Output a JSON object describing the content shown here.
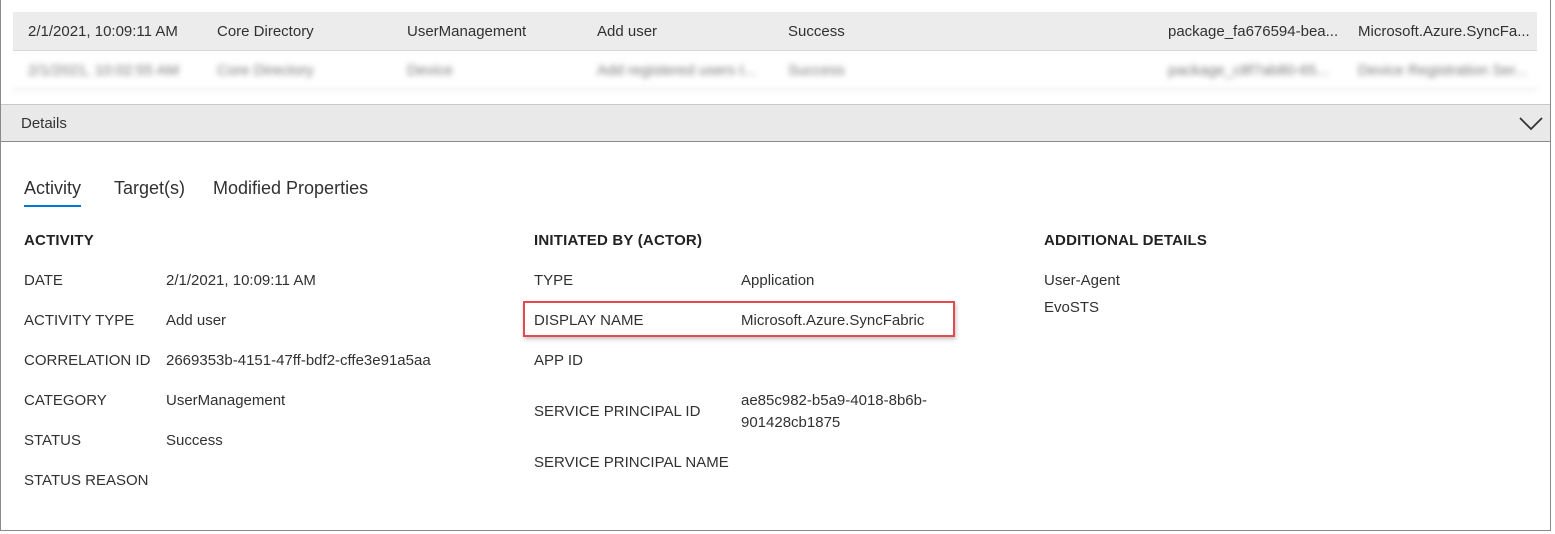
{
  "table": {
    "rows": [
      {
        "date": "2/1/2021, 10:09:11 AM",
        "service": "Core Directory",
        "category": "UserManagement",
        "activity": "Add user",
        "status": "Success",
        "correlation": "package_fa676594-bea...",
        "initiator": "Microsoft.Azure.SyncFa..."
      },
      {
        "date": "2/1/2021, 10:02:55 AM",
        "service": "Core Directory",
        "category": "Device",
        "activity": "Add registered users t...",
        "status": "Success",
        "correlation": "package_c8f7ab80-65...",
        "initiator": "Device Registration Ser..."
      }
    ]
  },
  "details": {
    "bar_label": "Details",
    "tabs": [
      "Activity",
      "Target(s)",
      "Modified Properties"
    ],
    "active_tab": "Activity",
    "activity": {
      "title": "ACTIVITY",
      "fields": [
        {
          "label": "DATE",
          "value": "2/1/2021, 10:09:11 AM"
        },
        {
          "label": "ACTIVITY TYPE",
          "value": "Add user"
        },
        {
          "label": "CORRELATION ID",
          "value": "2669353b-4151-47ff-bdf2-cffe3e91a5aa"
        },
        {
          "label": "CATEGORY",
          "value": "UserManagement"
        },
        {
          "label": "STATUS",
          "value": "Success"
        },
        {
          "label": "STATUS REASON",
          "value": ""
        }
      ]
    },
    "initiated_by": {
      "title": "INITIATED BY (ACTOR)",
      "fields": [
        {
          "label": "TYPE",
          "value": "Application"
        },
        {
          "label": "DISPLAY NAME",
          "value": "Microsoft.Azure.SyncFabric"
        },
        {
          "label": "APP ID",
          "value": ""
        },
        {
          "label": "SERVICE PRINCIPAL ID",
          "value": "ae85c982-b5a9-4018-8b6b-901428cb1875"
        },
        {
          "label": "SERVICE PRINCIPAL NAME",
          "value": ""
        }
      ]
    },
    "additional": {
      "title": "ADDITIONAL DETAILS",
      "key": "User-Agent",
      "value": "EvoSTS"
    }
  },
  "colors": {
    "accent": "#0078d4",
    "highlight": "#e5484d",
    "selected_row": "#ececec",
    "details_bar": "#e9e9e9"
  },
  "icons": {
    "collapse": "chevron-down-icon"
  }
}
